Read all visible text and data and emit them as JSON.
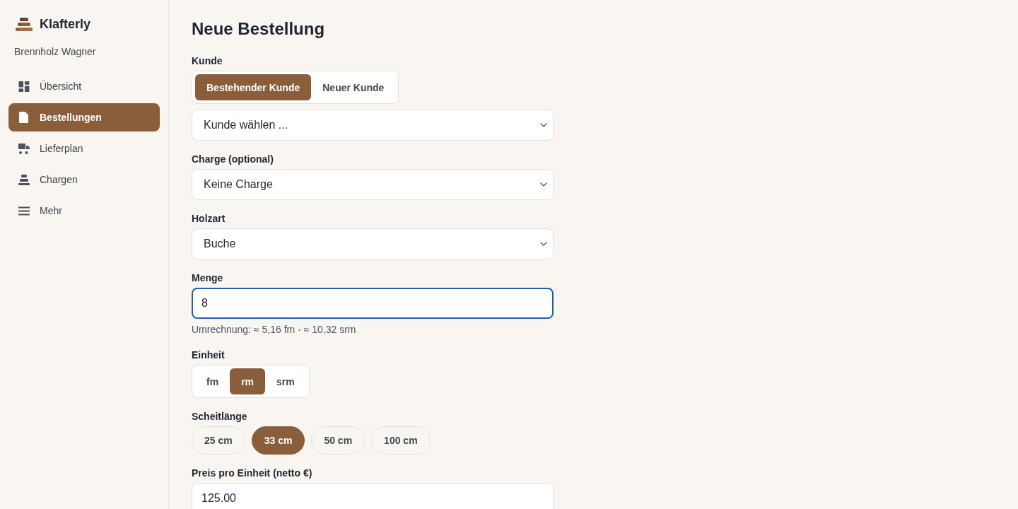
{
  "sidebar": {
    "brand": "Klafterly",
    "account": "Brennholz Wagner",
    "items": [
      {
        "label": "Übersicht",
        "selected": false
      },
      {
        "label": "Bestellungen",
        "selected": true
      },
      {
        "label": "Lieferplan",
        "selected": false
      },
      {
        "label": "Chargen",
        "selected": false
      },
      {
        "label": "Mehr",
        "selected": false
      }
    ]
  },
  "page": {
    "title": "Neue Bestellung"
  },
  "form": {
    "fields": [
      {
        "kind": "segmented",
        "label": "Kunde",
        "options": [
          {
            "label": "Bestehender Kunde",
            "selected": true
          },
          {
            "label": "Neuer Kunde",
            "selected": false
          }
        ]
      },
      {
        "kind": "select",
        "value": "Kunde wählen ..."
      },
      {
        "kind": "select",
        "label": "Charge (optional)",
        "value": "Keine Charge"
      },
      {
        "kind": "select",
        "label": "Holzart",
        "value": "Buche"
      },
      {
        "kind": "input",
        "label": "Menge",
        "value": "8",
        "focused": true,
        "hint": "Umrechnung: ≈ 5,16 fm · ≈ 10,32 srm"
      },
      {
        "kind": "segmented",
        "label": "Einheit",
        "options": [
          {
            "label": "fm",
            "selected": false
          },
          {
            "label": "rm",
            "selected": true
          },
          {
            "label": "srm",
            "selected": false
          }
        ]
      },
      {
        "kind": "pills",
        "label": "Scheitlänge",
        "options": [
          {
            "label": "25 cm",
            "selected": false
          },
          {
            "label": "33 cm",
            "selected": true
          },
          {
            "label": "50 cm",
            "selected": false
          },
          {
            "label": "100 cm",
            "selected": false
          }
        ]
      },
      {
        "kind": "input",
        "label": "Preis pro Einheit (netto €)",
        "value": "125.00",
        "focused": false
      }
    ]
  }
}
